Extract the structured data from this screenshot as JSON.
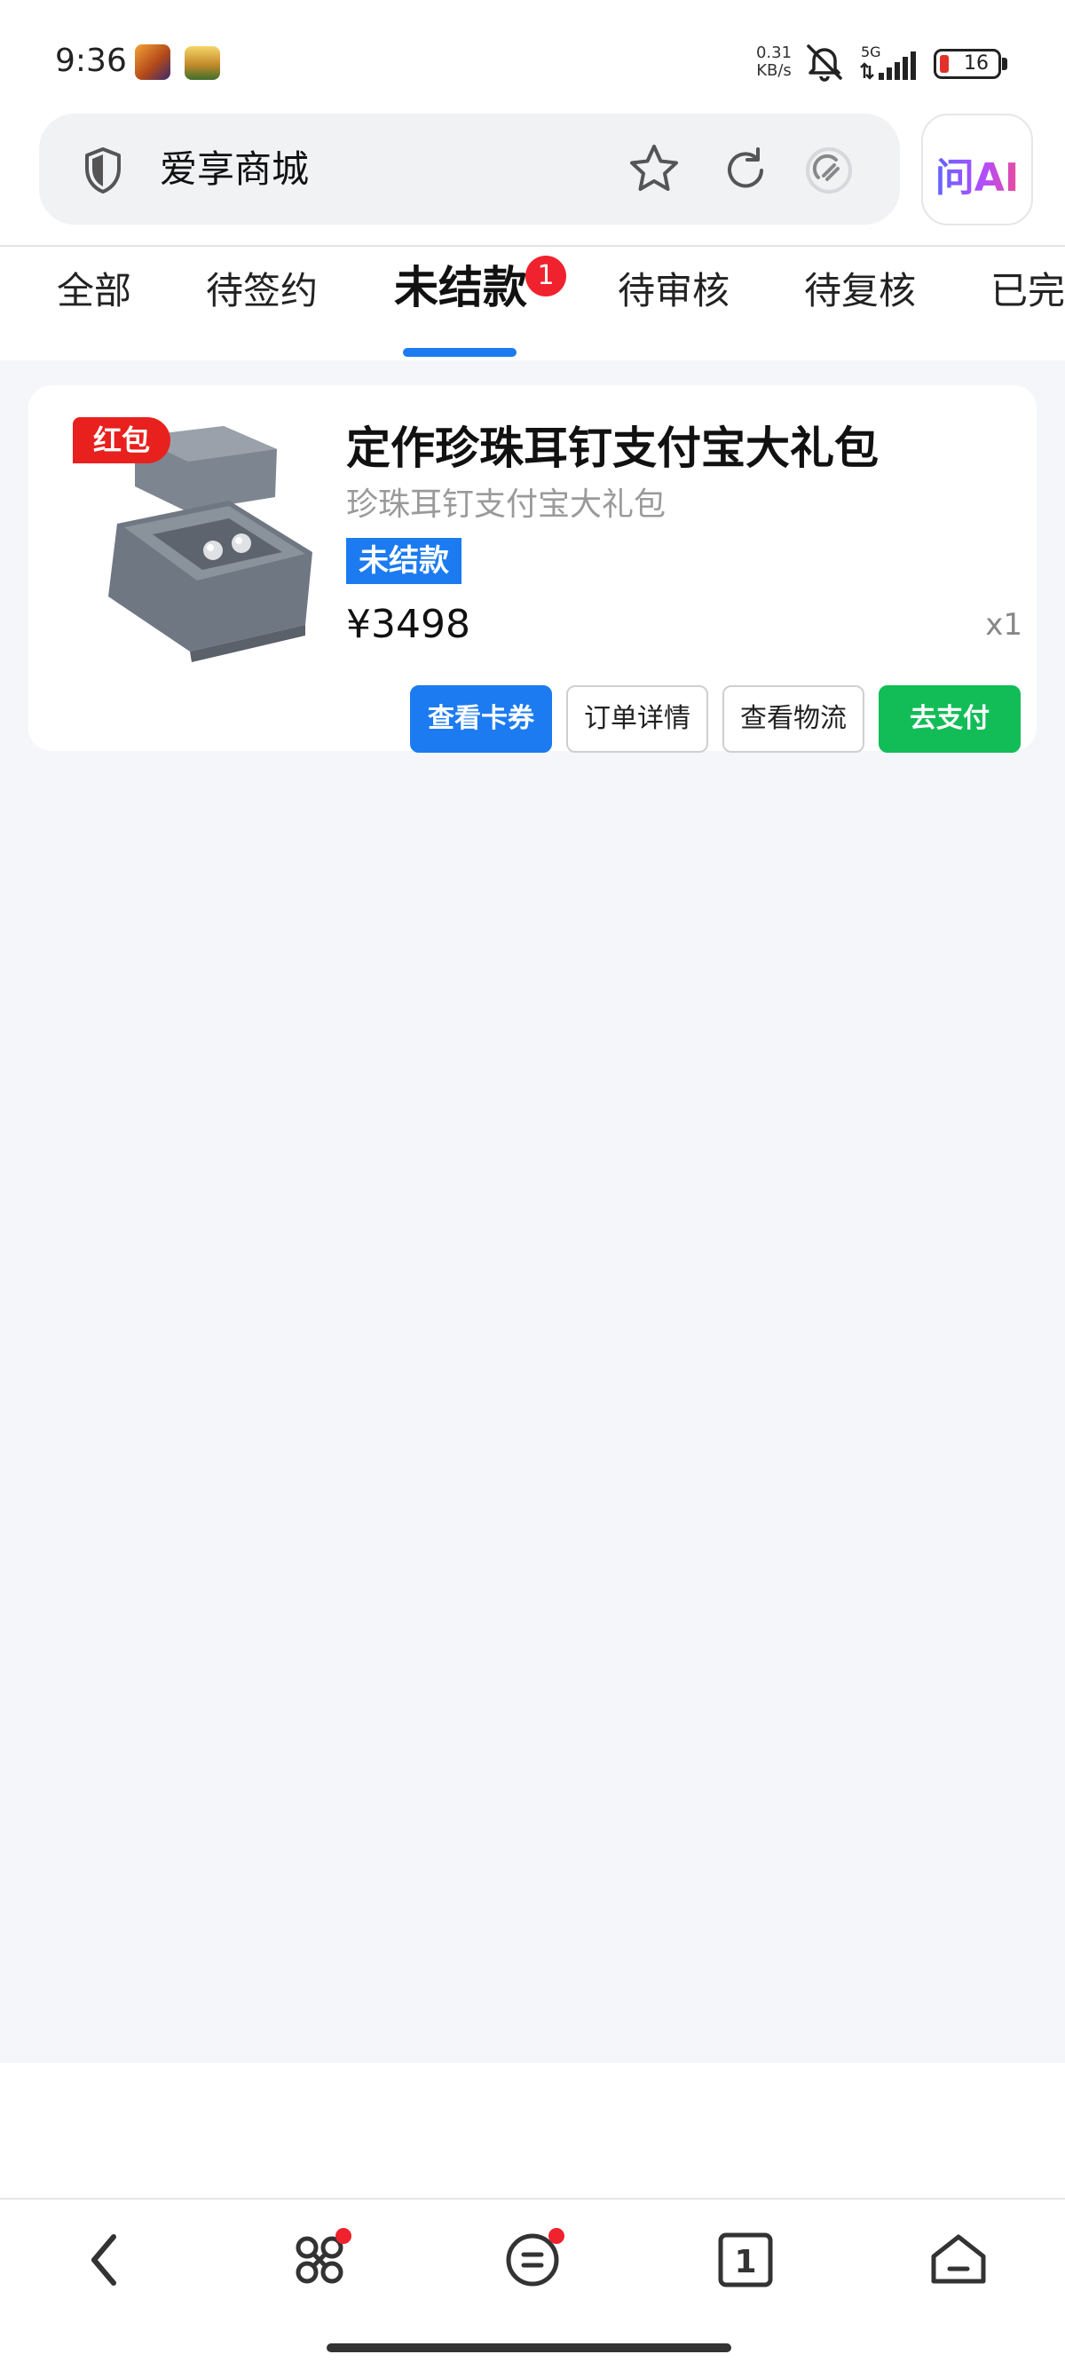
{
  "status_bar": {
    "time": "9:36",
    "net_speed_value": "0.31",
    "net_speed_unit": "KB/s",
    "network_type": "5G",
    "battery_level": "16",
    "icons": [
      "mute-icon",
      "signal-icon",
      "battery-icon"
    ]
  },
  "browser": {
    "page_title": "爱享商城",
    "ai_button_label": "问AI",
    "icons": [
      "shield-icon",
      "star-icon",
      "refresh-icon",
      "speed-icon"
    ]
  },
  "tabs": [
    {
      "label": "全部"
    },
    {
      "label": "待签约"
    },
    {
      "label": "未结款",
      "active": true,
      "badge": "1"
    },
    {
      "label": "待审核"
    },
    {
      "label": "待复核"
    },
    {
      "label": "已完"
    }
  ],
  "orders": [
    {
      "promo_tag": "红包",
      "title": "定作珍珠耳钉支付宝大礼包",
      "subtitle": "珍珠耳钉支付宝大礼包",
      "status": "未结款",
      "price": "¥3498",
      "quantity": "x1",
      "actions": [
        "查看卡券",
        "订单详情",
        "查看物流",
        "去支付"
      ]
    }
  ],
  "bottom_nav": {
    "items": [
      "back-icon",
      "apps-icon",
      "menu-icon",
      "tabs-icon",
      "home-icon"
    ],
    "tab_count": "1"
  },
  "colors": {
    "accent_blue": "#1c7bf0",
    "pay_green": "#12bd57",
    "badge_red": "#f0222e",
    "content_bg": "#f4f6fa"
  }
}
